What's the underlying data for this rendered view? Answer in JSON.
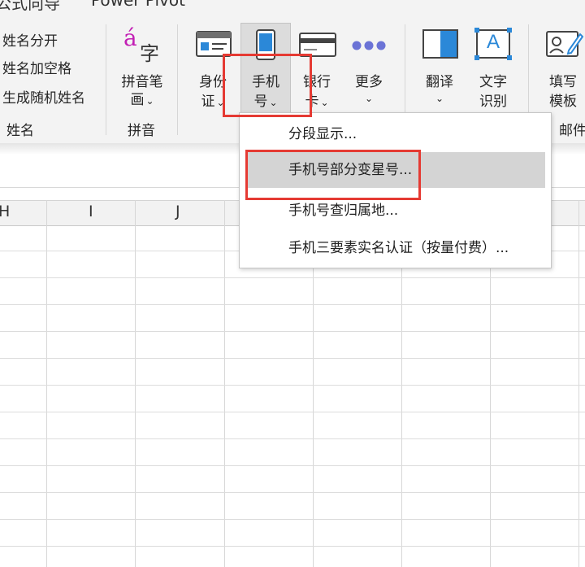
{
  "tabs": {
    "formula_partial": "公式向导",
    "power_pivot_partial": "Power Pivot"
  },
  "name_group": {
    "items": [
      "姓名分开",
      "姓名加空格",
      "生成随机姓名"
    ],
    "label": "姓名"
  },
  "pinyin_group": {
    "icon_text_a": "á",
    "icon_text_zi": "字",
    "button_line1": "拼音笔",
    "button_line2": "画",
    "label": "拼音"
  },
  "card_group": {
    "id_card": {
      "line1": "身份",
      "line2": "证"
    },
    "phone": {
      "line1": "手机",
      "line2": "号"
    },
    "bank_card": {
      "line1": "银行",
      "line2": "卡"
    },
    "more": {
      "line1": "更多"
    }
  },
  "translate_group": {
    "translate": {
      "line1": "翻译"
    },
    "ocr": {
      "line1": "文字",
      "line2": "识别",
      "icon_letter": "A"
    }
  },
  "mail_group": {
    "fill_template": {
      "line1": "填写",
      "line2": "模板"
    },
    "label_partial": "邮件"
  },
  "columns": [
    "H",
    "I",
    "J"
  ],
  "phone_menu": {
    "items": [
      "分段显示...",
      "手机号部分变星号...",
      "手机号查归属地...",
      "手机三要素实名认证（按量付费）..."
    ]
  },
  "colors": {
    "highlight_red": "#e53a33",
    "pinyin_magenta": "#c21fb4",
    "ribbon_bg": "#f3f3f3",
    "menu_highlight": "#d4d4d4"
  }
}
